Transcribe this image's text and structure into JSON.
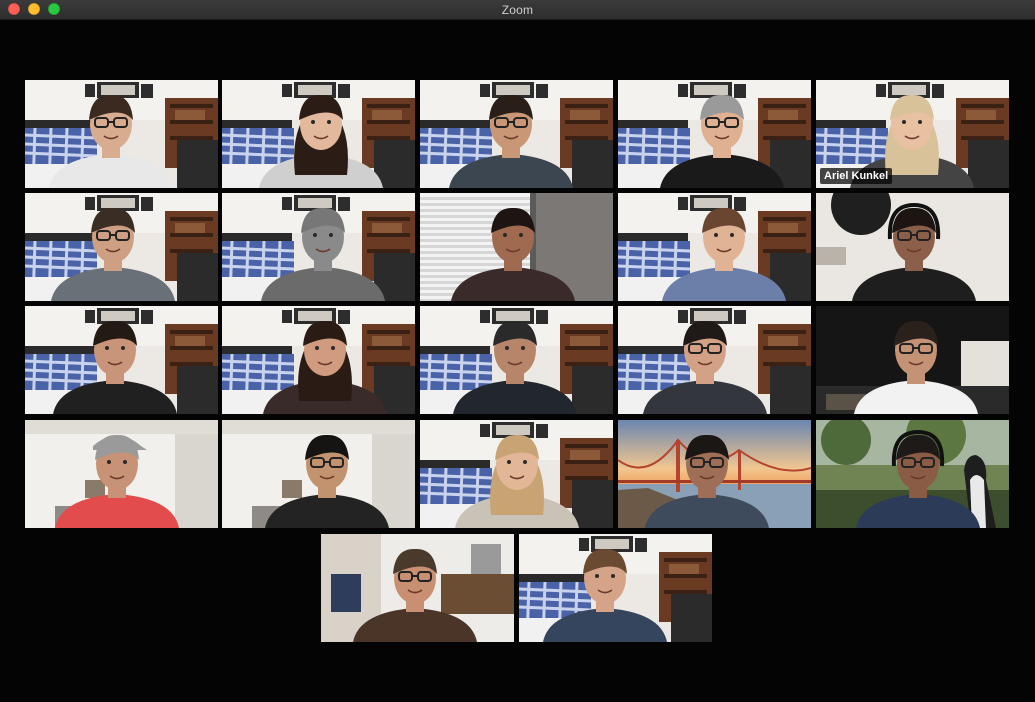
{
  "app": {
    "window_title": "Zoom"
  },
  "gallery": {
    "active_speaker": {
      "name": "Ariel Kunkel"
    },
    "participant_count": 22
  },
  "colors": {
    "active_border": "#d8dd8a",
    "background": "#040404"
  }
}
